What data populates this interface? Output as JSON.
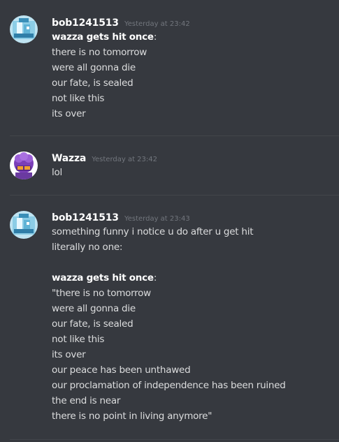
{
  "messages": [
    {
      "username": "bob1241513",
      "timestamp": "Yesterday at 23:42",
      "avatar_icon": "ice-avatar-icon",
      "lines": [
        {
          "bold": "wazza gets hit once",
          "rest": ":"
        },
        {
          "text": "there is no tomorrow"
        },
        {
          "text": "were all gonna die"
        },
        {
          "text": "our fate, is sealed"
        },
        {
          "text": "not like this"
        },
        {
          "text": "its over"
        }
      ]
    },
    {
      "username": "Wazza",
      "timestamp": "Yesterday at 23:42",
      "avatar_icon": "purple-character-avatar-icon",
      "lines": [
        {
          "text": "lol"
        }
      ]
    },
    {
      "username": "bob1241513",
      "timestamp": "Yesterday at 23:43",
      "avatar_icon": "ice-avatar-icon",
      "lines": [
        {
          "text": "something funny i notice u do after u get hit"
        },
        {
          "text": "literally no one:"
        },
        {
          "text": ""
        },
        {
          "bold": "wazza gets hit once",
          "rest": ":"
        },
        {
          "text": "\"there is no tomorrow"
        },
        {
          "text": "were all gonna die"
        },
        {
          "text": "our fate, is sealed"
        },
        {
          "text": "not like this"
        },
        {
          "text": "its over"
        },
        {
          "text": "our peace has been unthawed"
        },
        {
          "text": "our proclamation of independence has been ruined"
        },
        {
          "text": "the end is near"
        },
        {
          "text": "there is no point in living anymore\""
        }
      ]
    }
  ],
  "colors": {
    "background": "#36393f",
    "username": "#ffffff",
    "timestamp": "#72767d",
    "text": "#dcddde",
    "divider": "#42454a"
  }
}
